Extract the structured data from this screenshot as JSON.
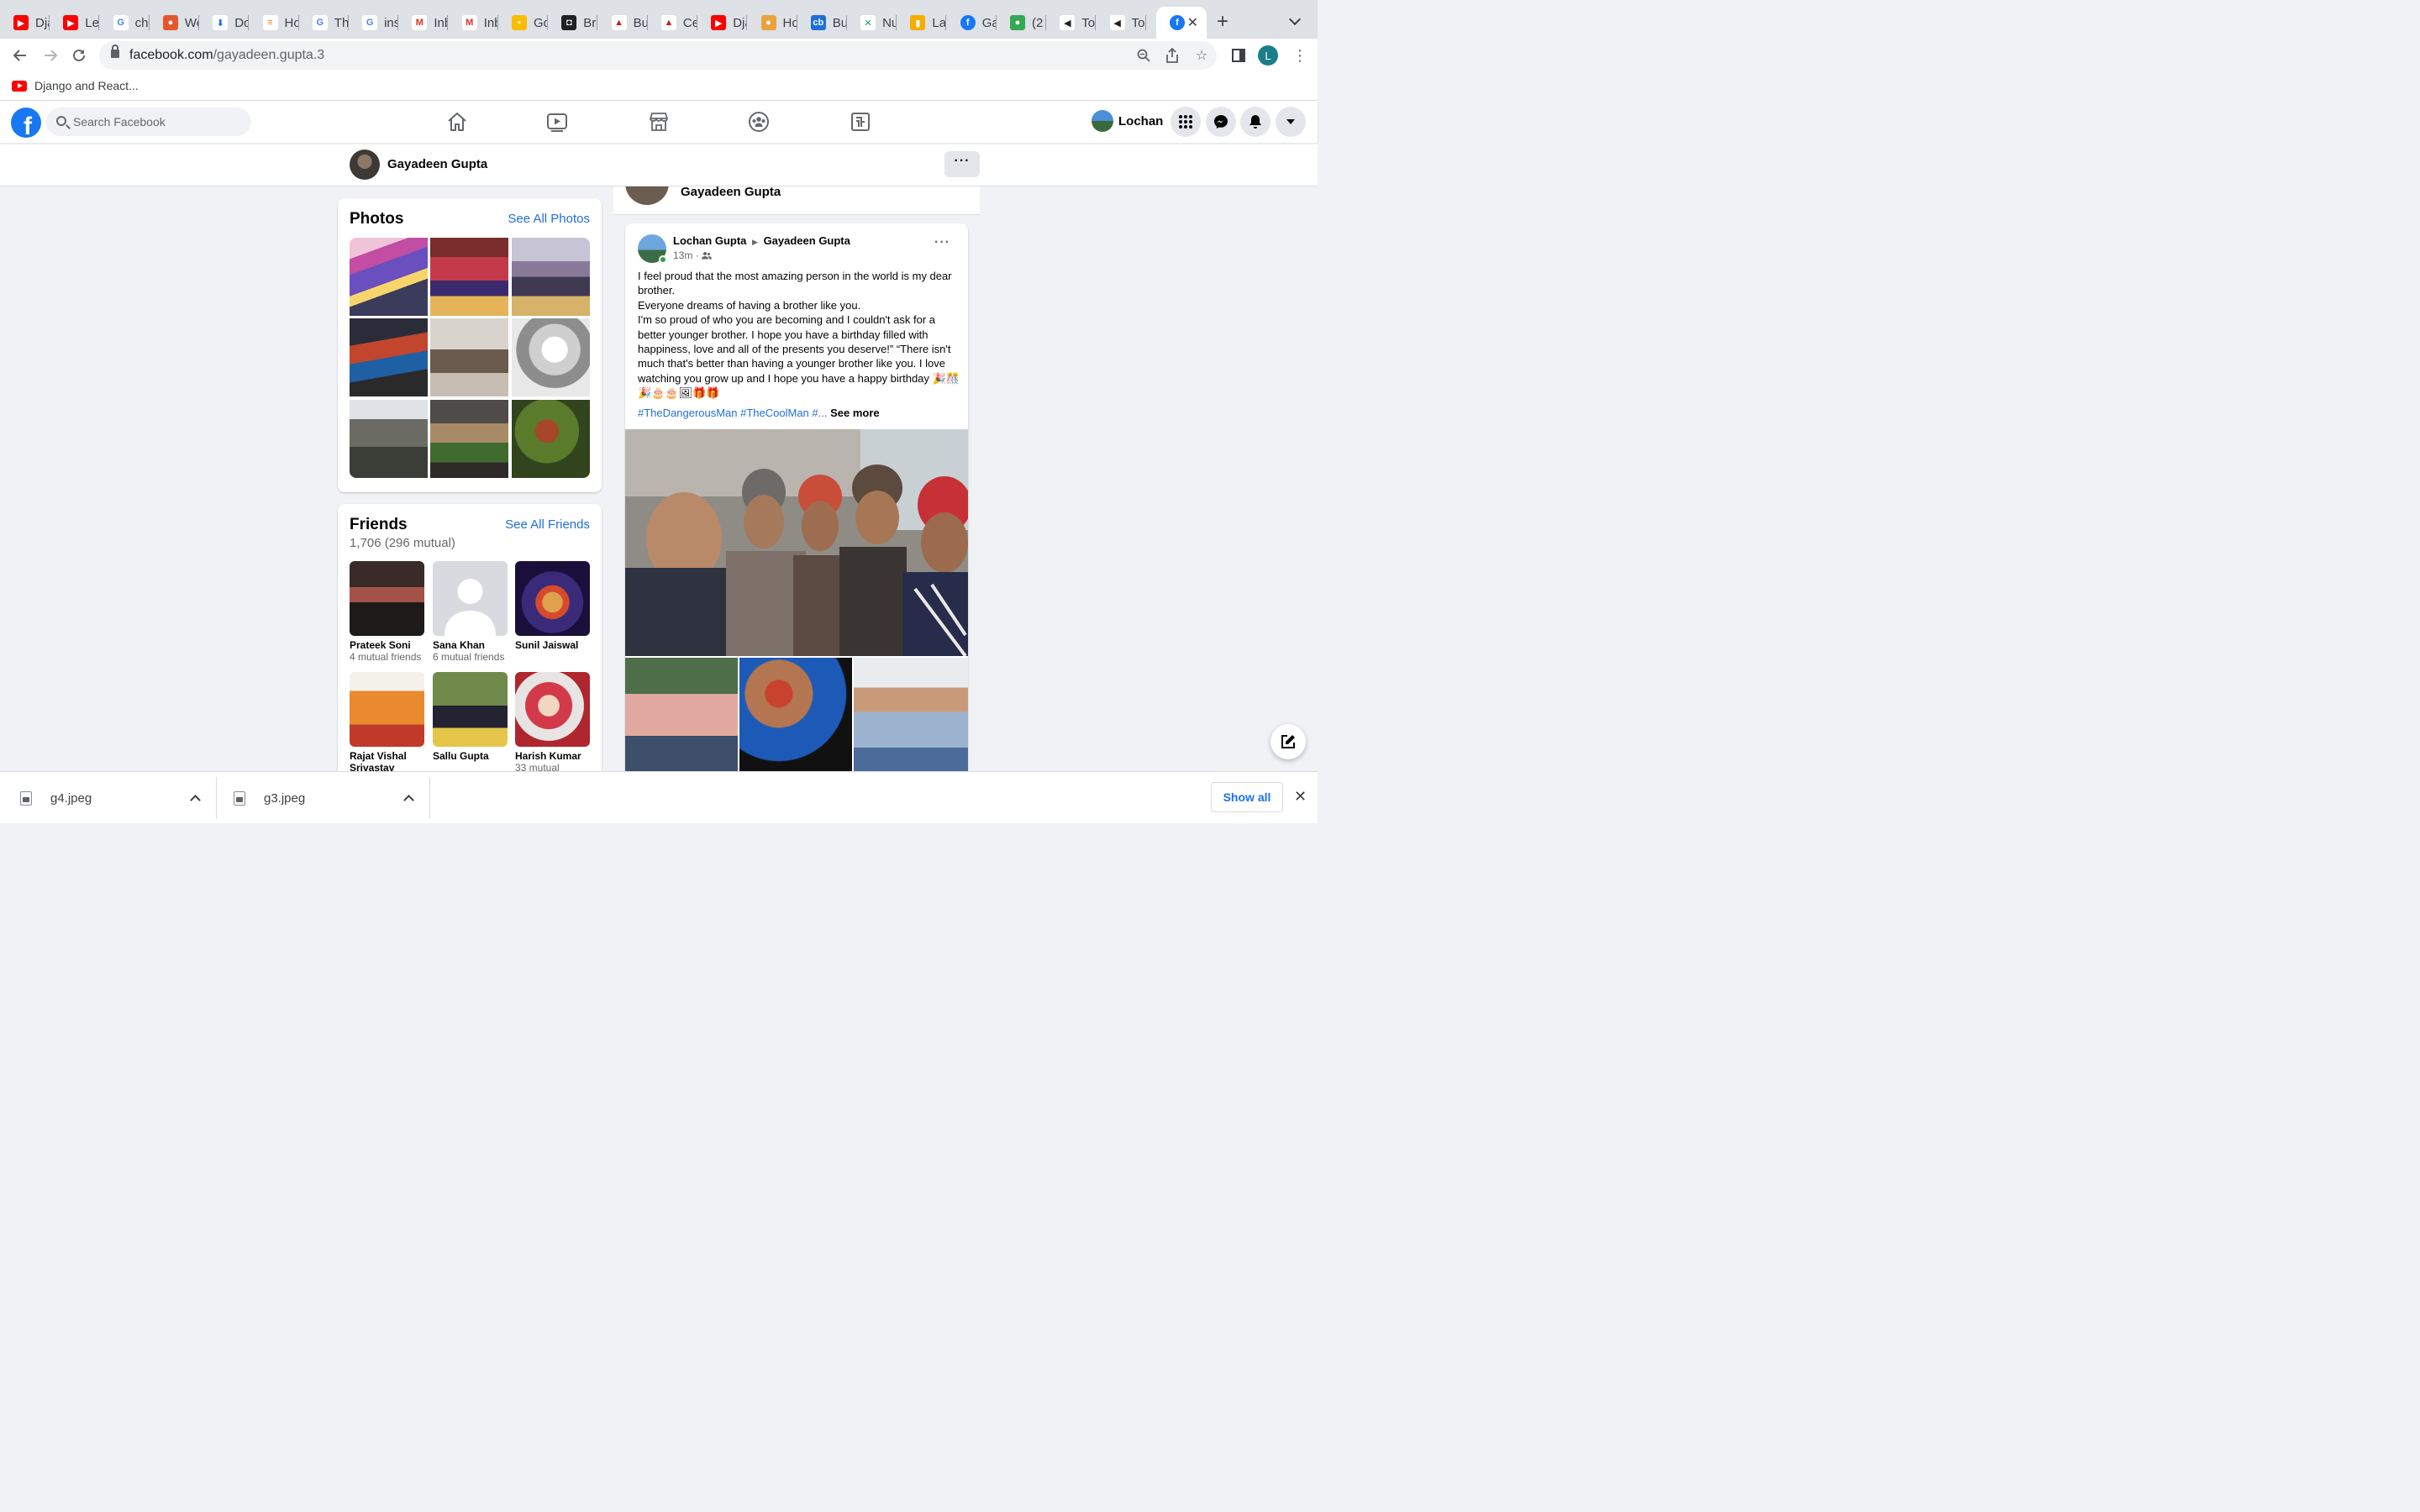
{
  "browser": {
    "tabs": [
      {
        "title": "Dja",
        "icon": "youtube-icon"
      },
      {
        "title": "Le",
        "icon": "youtube-icon"
      },
      {
        "title": "ch",
        "icon": "google-icon"
      },
      {
        "title": "We",
        "icon": "red-app-icon"
      },
      {
        "title": "Do",
        "icon": "download-icon"
      },
      {
        "title": "Ho",
        "icon": "stackoverflow-icon"
      },
      {
        "title": "Th",
        "icon": "google-icon"
      },
      {
        "title": "ins",
        "icon": "google-icon"
      },
      {
        "title": "Inb",
        "icon": "gmail-icon"
      },
      {
        "title": "Inb",
        "icon": "gmail-icon"
      },
      {
        "title": "Go",
        "icon": "keep-icon"
      },
      {
        "title": "Br",
        "icon": "dark-app-icon"
      },
      {
        "title": "Bu",
        "icon": "chart-icon"
      },
      {
        "title": "Ce",
        "icon": "chart-icon"
      },
      {
        "title": "Dja",
        "icon": "youtube-icon"
      },
      {
        "title": "Ho",
        "icon": "tiger-icon"
      },
      {
        "title": "Bu",
        "icon": "cb-icon"
      },
      {
        "title": "Nu",
        "icon": "x-icon"
      },
      {
        "title": "La",
        "icon": "analytics-icon"
      },
      {
        "title": "Ga",
        "icon": "facebook-icon"
      },
      {
        "title": "(2",
        "icon": "whatsapp-icon"
      },
      {
        "title": "To",
        "icon": "megaphone-icon"
      },
      {
        "title": "To",
        "icon": "megaphone-icon"
      }
    ],
    "active_tab_icon": "facebook-icon",
    "url_host": "facebook.com",
    "url_path": "/gayadeen.gupta.3",
    "profile_initial": "L",
    "bookmark": "Django and React..."
  },
  "fb": {
    "search_placeholder": "Search Facebook",
    "user_name": "Lochan",
    "profile_name": "Gayadeen Gupta",
    "photos": {
      "title": "Photos",
      "see_all": "See All Photos"
    },
    "friends": {
      "title": "Friends",
      "count": "1,706 (296 mutual)",
      "see_all": "See All Friends",
      "list": [
        {
          "name": "Prateek Soni",
          "mutual": "4 mutual friends"
        },
        {
          "name": "Sana Khan",
          "mutual": "6 mutual friends"
        },
        {
          "name": "Sunil Jaiswal",
          "mutual": ""
        },
        {
          "name": "Rajat Vishal Srivastav",
          "mutual": ""
        },
        {
          "name": "Sallu Gupta",
          "mutual": ""
        },
        {
          "name": "Harish Kumar",
          "mutual": "33 mutual"
        }
      ]
    },
    "post": {
      "author": "Lochan Gupta",
      "target": "Gayadeen Gupta",
      "time": "13m · ",
      "body": "I feel proud that the most amazing person in the world is my dear brother.\nEveryone dreams of having a brother like you.\nI'm so proud of who you are becoming and I couldn't ask for a better younger brother. I hope you have a birthday filled with happiness, love and all of the presents you deserve!” “There isn't much that's better than having a younger  brother like you. I love watching you grow up and I hope you have a happy birthday 🎉🎊🎉🎂🎂🖼🎁🎁",
      "tags": "#TheDangerousMan #TheCoolMan #...",
      "see_more": "See more"
    }
  },
  "downloads": {
    "items": [
      {
        "name": "g4.jpeg"
      },
      {
        "name": "g3.jpeg"
      }
    ],
    "show_all": "Show all"
  }
}
